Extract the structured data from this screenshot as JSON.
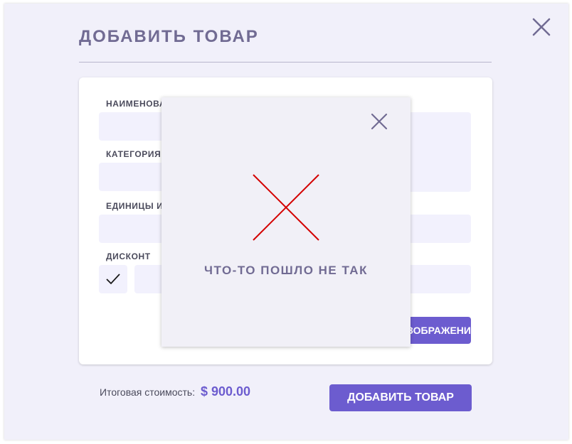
{
  "modal": {
    "title": "ДОБАВИТЬ ТОВАР",
    "close_icon": "close-icon"
  },
  "form": {
    "name_label": "НАИМЕНОВАНИЕ",
    "category_label": "КАТЕГОРИЯ",
    "units_label": "ЕДИНИЦЫ ИЗМЕРЕНИЯ",
    "discount_label": "ДИСКОНТ",
    "discount_checked": true,
    "image_button_label": "ИЗОБРАЖЕНИЕ"
  },
  "footer": {
    "total_label": "Итоговая стоимость:",
    "total_value": "$ 900.00",
    "add_button_label": "ДОБАВИТЬ ТОВАР"
  },
  "error_dialog": {
    "message": "ЧТО-ТО ПОШЛО НЕ ТАК",
    "close_icon": "close-icon",
    "status_icon": "error-x-icon"
  },
  "colors": {
    "accent": "#6c5ccf",
    "title": "#716b93",
    "background": "#f1f0fa",
    "field": "#f2f1fd",
    "error": "#d40000"
  }
}
